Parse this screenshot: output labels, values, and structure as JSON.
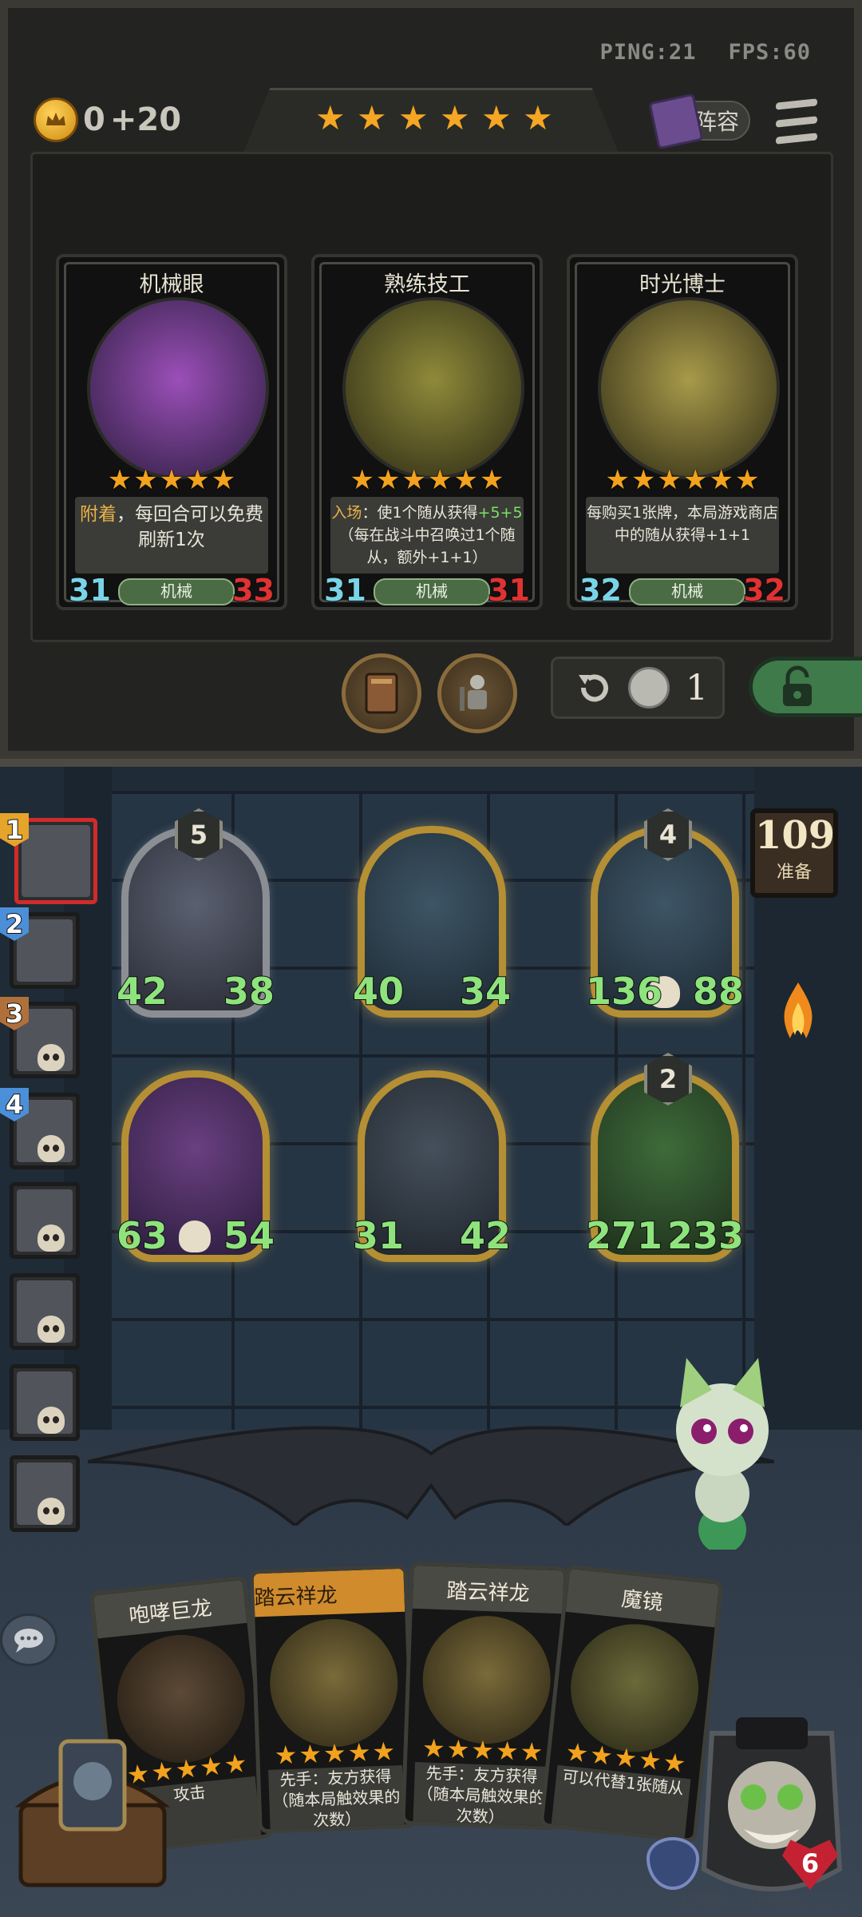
{
  "status": {
    "ping": "PING:21",
    "fps": "FPS:60"
  },
  "gold": {
    "amount": "0",
    "income": "+20"
  },
  "tavern_tier_stars": 6,
  "lineup_button": "阵容",
  "shop_cards": [
    {
      "name": "机械眼",
      "stars": 5,
      "desc_parts": [
        {
          "t": "附着",
          "c": "y"
        },
        {
          "t": "，每回合可以免费刷新1次",
          "c": ""
        }
      ],
      "small": false,
      "tribe": "机械",
      "attack": "31",
      "health": "33",
      "colors": [
        "#9b4fb8",
        "#2a1d3d"
      ]
    },
    {
      "name": "熟练技工",
      "stars": 6,
      "desc_parts": [
        {
          "t": "入场",
          "c": "y"
        },
        {
          "t": "：使1个随从获得",
          "c": ""
        },
        {
          "t": "+5+5",
          "c": "g"
        },
        {
          "t": "（每在战斗中召唤过1个随从，额外+1+1）",
          "c": ""
        }
      ],
      "small": true,
      "tribe": "机械",
      "attack": "31",
      "health": "31",
      "colors": [
        "#8f8a3a",
        "#2a2814"
      ]
    },
    {
      "name": "时光博士",
      "stars": 6,
      "desc_parts": [
        {
          "t": "每购买1张牌，本局游戏商店中的随从获得",
          "c": ""
        },
        {
          "t": "+1+1",
          "c": ""
        }
      ],
      "small": true,
      "tribe": "机械",
      "attack": "32",
      "health": "32",
      "colors": [
        "#a89a4a",
        "#2d2a14"
      ]
    }
  ],
  "refresh": {
    "cost": "1"
  },
  "ready_panel": {
    "count": "109",
    "label": "准备"
  },
  "players": [
    {
      "rank": "1",
      "me": true,
      "dead": false,
      "rank_color": "#e5a52a"
    },
    {
      "rank": "2",
      "me": false,
      "dead": false,
      "rank_color": "#4b8fd9"
    },
    {
      "rank": "3",
      "me": false,
      "dead": true,
      "rank_color": "#b0703b"
    },
    {
      "rank": "4",
      "me": false,
      "dead": true,
      "rank_color": "#4b8fd9"
    },
    {
      "rank": "",
      "me": false,
      "dead": true,
      "rank_color": ""
    },
    {
      "rank": "",
      "me": false,
      "dead": true,
      "rank_color": ""
    },
    {
      "rank": "",
      "me": false,
      "dead": true,
      "rank_color": ""
    },
    {
      "rank": "",
      "me": false,
      "dead": true,
      "rank_color": ""
    }
  ],
  "board_minions": [
    {
      "tier": "5",
      "attack": "42",
      "health": "38",
      "frame": "gray",
      "skull": false,
      "colors": [
        "#5a6070",
        "#2a2c36"
      ]
    },
    {
      "tier": "",
      "attack": "40",
      "health": "34",
      "frame": "gold",
      "skull": false,
      "colors": [
        "#3d5566",
        "#1e2a33"
      ]
    },
    {
      "tier": "4",
      "attack": "136",
      "health": "88",
      "frame": "gold",
      "skull": true,
      "colors": [
        "#3d5566",
        "#1e2a33"
      ]
    },
    {
      "tier": "",
      "attack": "63",
      "health": "54",
      "frame": "gold",
      "skull": true,
      "colors": [
        "#6a3f80",
        "#2a1d3d"
      ]
    },
    {
      "tier": "",
      "attack": "31",
      "health": "42",
      "frame": "gold",
      "skull": false,
      "colors": [
        "#45505c",
        "#1f252c"
      ]
    },
    {
      "tier": "2",
      "attack": "271",
      "health": "233",
      "frame": "gold",
      "skull": false,
      "colors": [
        "#3e6b3a",
        "#1d2f1b"
      ]
    }
  ],
  "hand_cards": [
    {
      "name": "咆哮巨龙",
      "desc": "攻击",
      "gold": false,
      "colors": [
        "#5c4a36",
        "#1f1810"
      ]
    },
    {
      "name": "踏云祥龙",
      "desc": "先手：友方获得（随本局触效果的次数）",
      "gold": true,
      "colors": [
        "#7a6b3a",
        "#2a2414"
      ]
    },
    {
      "name": "踏云祥龙",
      "desc": "先手：友方获得（随本局触效果的次数）",
      "gold": false,
      "colors": [
        "#7a6b3a",
        "#2a2414"
      ]
    },
    {
      "name": "魔镜",
      "desc": "可以代替1张随从",
      "gold": false,
      "colors": [
        "#6b6a3a",
        "#262414"
      ]
    }
  ],
  "hero": {
    "health": "6"
  },
  "user_id": "1900 764682237"
}
